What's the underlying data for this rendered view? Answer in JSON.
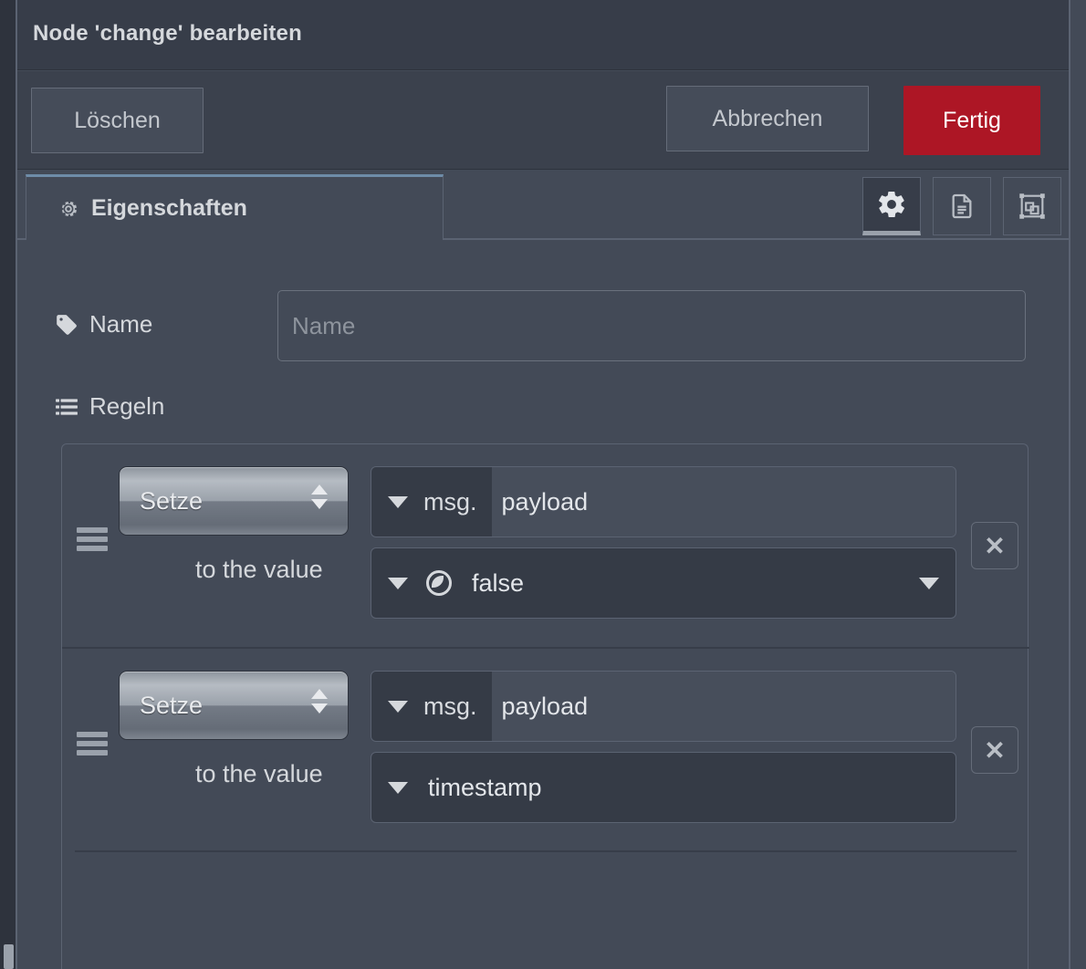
{
  "window": {
    "title": "Node 'change' bearbeiten"
  },
  "actions": {
    "delete_label": "Löschen",
    "cancel_label": "Abbrechen",
    "done_label": "Fertig",
    "done_color": "#ad1625"
  },
  "tabs": {
    "active_tab": {
      "label": "Eigenschaften",
      "icon": "gear-icon"
    },
    "icon_buttons": [
      {
        "name": "properties-gear-icon",
        "active": true
      },
      {
        "name": "description-document-icon",
        "active": false
      },
      {
        "name": "appearance-group-icon",
        "active": false
      }
    ]
  },
  "form": {
    "name": {
      "icon": "tag-icon",
      "label": "Name",
      "value": "",
      "placeholder": "Name"
    },
    "rules": {
      "icon": "list-icon",
      "label": "Regeln",
      "to_the_value_label": "to the value",
      "delete_rule_label": "✕",
      "items": [
        {
          "action": "Setze",
          "property_type_prefix": "msg.",
          "property": "payload",
          "value_type_icon": "boolean-icon",
          "value": "false",
          "has_value_dropdown": true
        },
        {
          "action": "Setze",
          "property_type_prefix": "msg.",
          "property": "payload",
          "value_type_icon": "none",
          "value": "timestamp",
          "has_value_dropdown": false
        }
      ]
    }
  },
  "theme": {
    "background": "#434a57",
    "header_background": "#373d49",
    "field_background": "#353b46",
    "border": "#5b6372",
    "text": "#d5d8dc",
    "accent_tab": "#6e8ca8"
  }
}
